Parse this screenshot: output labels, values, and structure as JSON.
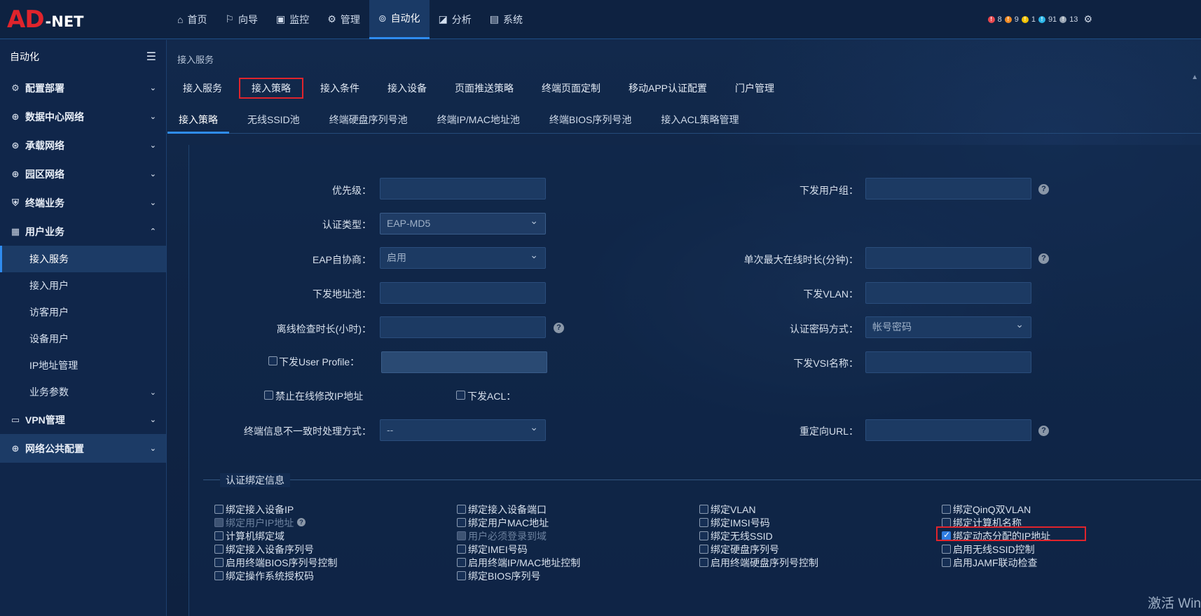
{
  "logo": {
    "brand": "AD",
    "suffix": "-NET"
  },
  "nav": [
    {
      "label": "首页",
      "icon": "home-icon",
      "glyph": "⌂"
    },
    {
      "label": "向导",
      "icon": "signpost-icon",
      "glyph": "⚐"
    },
    {
      "label": "监控",
      "icon": "monitor-icon",
      "glyph": "▣"
    },
    {
      "label": "管理",
      "icon": "gear-icon",
      "glyph": "⚙"
    },
    {
      "label": "自动化",
      "icon": "automation-icon",
      "glyph": "⊚"
    },
    {
      "label": "分析",
      "icon": "chart-icon",
      "glyph": "◪"
    },
    {
      "label": "系统",
      "icon": "system-icon",
      "glyph": "▤"
    }
  ],
  "status": {
    "red": "8",
    "orange": "9",
    "yellow": "1",
    "blue": "91",
    "gray": "13"
  },
  "status_colors": {
    "red": "#e8494f",
    "orange": "#f08a24",
    "yellow": "#f2c200",
    "blue": "#2bb6e8",
    "gray": "#9aa6b4"
  },
  "sidebar": {
    "title": "自动化",
    "groups": [
      {
        "label": "配置部署",
        "glyph": "⚙"
      },
      {
        "label": "数据中心网络",
        "glyph": "⊕"
      },
      {
        "label": "承载网络",
        "glyph": "⊛"
      },
      {
        "label": "园区网络",
        "glyph": "⊕"
      },
      {
        "label": "终端业务",
        "glyph": "⛨"
      },
      {
        "label": "用户业务",
        "glyph": "▦"
      }
    ],
    "subs": [
      "接入服务",
      "接入用户",
      "访客用户",
      "设备用户",
      "IP地址管理",
      "业务参数"
    ],
    "groups2": [
      {
        "label": "VPN管理",
        "glyph": "▭"
      },
      {
        "label": "网络公共配置",
        "glyph": "⊕"
      }
    ]
  },
  "breadcrumb": "接入服务",
  "tabs1": [
    "接入服务",
    "接入策略",
    "接入条件",
    "接入设备",
    "页面推送策略",
    "终端页面定制",
    "移动APP认证配置",
    "门户管理"
  ],
  "tabs2": [
    "接入策略",
    "无线SSID池",
    "终端硬盘序列号池",
    "终端IP/MAC地址池",
    "终端BIOS序列号池",
    "接入ACL策略管理"
  ],
  "form": {
    "priority": "优先级：",
    "user_group": "下发用户组：",
    "auth_type": "认证类型：",
    "auth_type_value": "EAP-MD5",
    "eap_nego": "EAP自协商：",
    "eap_nego_value": "启用",
    "max_online": "单次最大在线时长(分钟)：",
    "addr_pool": "下发地址池：",
    "vlan": "下发VLAN：",
    "offline_check": "离线检查时长(小时)：",
    "pwd_mode": "认证密码方式：",
    "pwd_mode_value": "帐号密码",
    "user_profile": "下发User Profile：",
    "vsi": "下发VSI名称：",
    "forbid_modify_ip": "禁止在线修改IP地址",
    "acl": "下发ACL：",
    "mismatch": "终端信息不一致时处理方式：",
    "mismatch_value": "--",
    "redirect": "重定向URL：",
    "help": "?"
  },
  "binding": {
    "legend": "认证绑定信息",
    "col1": [
      "绑定接入设备IP",
      "绑定用户IP地址",
      "计算机绑定域",
      "绑定接入设备序列号",
      "启用终端BIOS序列号控制",
      "绑定操作系统授权码"
    ],
    "col2": [
      "绑定接入设备端口",
      "绑定用户MAC地址",
      "用户必须登录到域",
      "绑定IMEI号码",
      "启用终端IP/MAC地址控制",
      "绑定BIOS序列号"
    ],
    "col3": [
      "绑定VLAN",
      "绑定IMSI号码",
      "绑定无线SSID",
      "绑定硬盘序列号",
      "启用终端硬盘序列号控制"
    ],
    "col4": [
      "绑定QinQ双VLAN",
      "绑定计算机名称",
      "绑定动态分配的IP地址",
      "启用无线SSID控制",
      "启用JAMF联动检查"
    ]
  },
  "watermark": "激活 Win"
}
